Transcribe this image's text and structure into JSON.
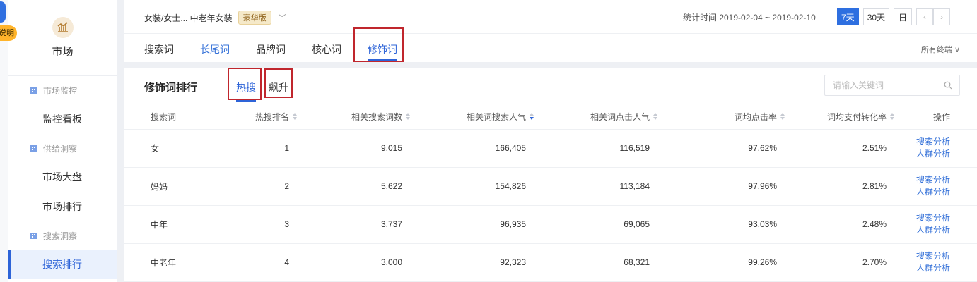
{
  "edge": {
    "badge_text": "说明"
  },
  "sidebar": {
    "brand_label": "市场",
    "groups": [
      {
        "label": "市场监控",
        "items": [
          "监控看板"
        ]
      },
      {
        "label": "供给洞察",
        "items": [
          "市场大盘",
          "市场排行"
        ]
      },
      {
        "label": "搜索洞察",
        "items": [
          "搜索排行"
        ]
      }
    ],
    "active_item": "搜索排行"
  },
  "header": {
    "category": "女装/女士... 中老年女装",
    "edition_badge": "豪华版",
    "date_range": "统计时间 2019-02-04 ~ 2019-02-10",
    "period_buttons": [
      "7天",
      "30天",
      "日"
    ],
    "active_period": "7天",
    "tabs": [
      "搜索词",
      "长尾词",
      "品牌词",
      "核心词",
      "修饰词"
    ],
    "active_tab": "修饰词",
    "terminal": "所有终端"
  },
  "main": {
    "title": "修饰词排行",
    "subtabs": [
      "热搜",
      "飙升"
    ],
    "active_subtab": "热搜",
    "search_placeholder": "请输入关键词",
    "columns": [
      "搜索词",
      "热搜排名",
      "相关搜索词数",
      "相关词搜索人气",
      "相关词点击人气",
      "词均点击率",
      "词均支付转化率",
      "操作"
    ],
    "sorted_column": "相关词搜索人气",
    "rows": [
      {
        "word": "女",
        "rank": "1",
        "count": "9,015",
        "search_pop": "166,405",
        "click_pop": "116,519",
        "ctr": "97.62%",
        "cvr": "2.51%"
      },
      {
        "word": "妈妈",
        "rank": "2",
        "count": "5,622",
        "search_pop": "154,826",
        "click_pop": "113,184",
        "ctr": "97.96%",
        "cvr": "2.81%"
      },
      {
        "word": "中年",
        "rank": "3",
        "count": "3,737",
        "search_pop": "96,935",
        "click_pop": "69,065",
        "ctr": "93.03%",
        "cvr": "2.48%"
      },
      {
        "word": "中老年",
        "rank": "4",
        "count": "3,000",
        "search_pop": "92,323",
        "click_pop": "68,321",
        "ctr": "99.26%",
        "cvr": "2.70%"
      }
    ],
    "row_actions": [
      "搜索分析",
      "人群分析"
    ]
  },
  "colors": {
    "accent": "#2e6fe0",
    "highlight_box": "#c0262d",
    "vip_badge": "#f5e9c9"
  }
}
